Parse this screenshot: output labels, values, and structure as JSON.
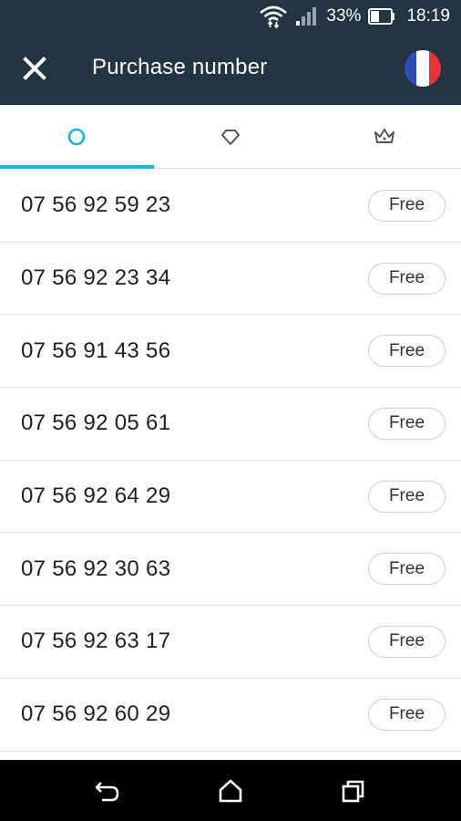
{
  "status_bar": {
    "battery_percent": "33%",
    "time": "18:19",
    "icons": [
      "wifi-icon",
      "signal-icon",
      "battery-icon"
    ]
  },
  "app_bar": {
    "title": "Purchase number",
    "close_icon": "close-icon",
    "country_flag": "france-flag-icon"
  },
  "tabs": [
    {
      "icon": "circle-icon",
      "active": true
    },
    {
      "icon": "diamond-icon",
      "active": false
    },
    {
      "icon": "crown-icon",
      "active": false
    }
  ],
  "numbers": [
    {
      "number": "07 56 92 59 23",
      "price": "Free"
    },
    {
      "number": "07 56 92 23 34",
      "price": "Free"
    },
    {
      "number": "07 56 91 43 56",
      "price": "Free"
    },
    {
      "number": "07 56 92 05 61",
      "price": "Free"
    },
    {
      "number": "07 56 92 64 29",
      "price": "Free"
    },
    {
      "number": "07 56 92 30 63",
      "price": "Free"
    },
    {
      "number": "07 56 92 63 17",
      "price": "Free"
    },
    {
      "number": "07 56 92 60 29",
      "price": "Free"
    }
  ],
  "nav_bar": {
    "icons": [
      "back-icon",
      "home-icon",
      "recents-icon"
    ]
  },
  "colors": {
    "app_bar": "#253441",
    "accent": "#17b6e0",
    "nav_bar": "#000000",
    "flag_blue": "#2b4fb3",
    "flag_white": "#ffffff",
    "flag_red": "#e8333d"
  }
}
